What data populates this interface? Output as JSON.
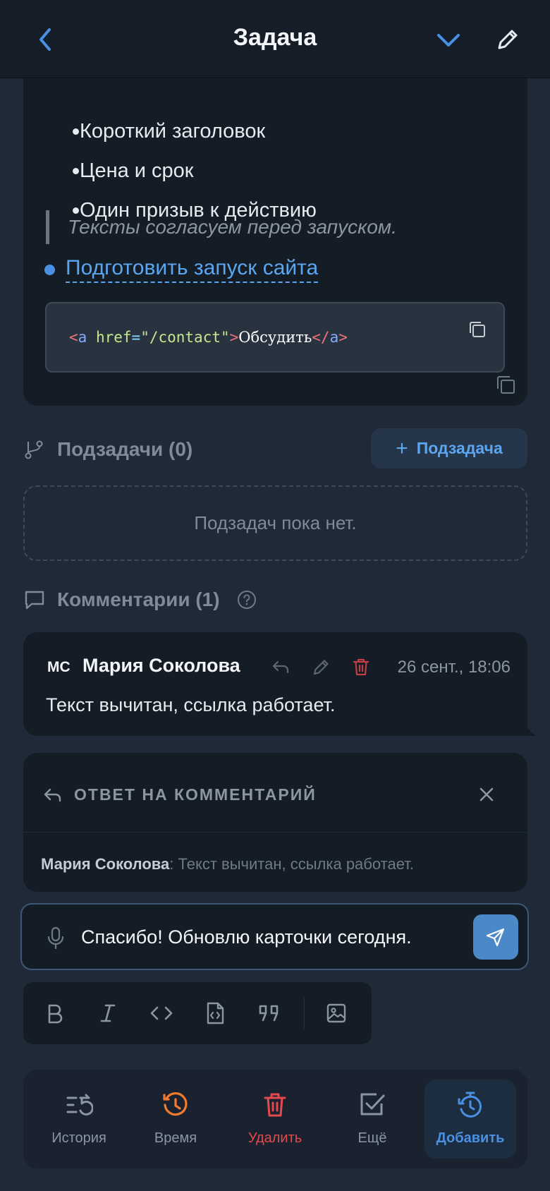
{
  "header": {
    "title": "Задача"
  },
  "description": {
    "bullets": [
      "Короткий заголовок",
      "Цена и срок",
      "Один призыв к действию"
    ],
    "quote": "Тексты согласуем перед запуском.",
    "task_link": "Подготовить запуск сайта",
    "code": {
      "open_bracket": "<",
      "tag": "a",
      "attr": "href",
      "eq": "=",
      "value": "\"/contact\"",
      "close_bracket": ">",
      "text": "Обсудить",
      "end_open": "</",
      "end_tag": "a",
      "end_close": ">"
    }
  },
  "subtasks": {
    "title": "Подзадачи (0)",
    "add_plus": "+",
    "add_label": "Подзадача",
    "empty_text": "Подзадач пока нет."
  },
  "comments": {
    "title": "Комментарии (1)",
    "items": [
      {
        "avatar": "МС",
        "author": "Мария Соколова",
        "time": "26 сент., 18:06",
        "text": "Текст вычитан, ссылка работает."
      }
    ]
  },
  "reply": {
    "label": "ОТВЕТ НА КОММЕНТАРИЙ",
    "quoted_author": "Мария Соколова",
    "separator": ":",
    "quoted_text": " Текст вычитан, ссылка работает."
  },
  "composer": {
    "value": "Спасибо! Обновлю карточки сегодня."
  },
  "toolbar": {
    "buttons": [
      "bold-icon",
      "italic-icon",
      "code-icon",
      "code-file-icon",
      "quote-icon",
      "image-icon"
    ]
  },
  "bottom_nav": {
    "items": [
      {
        "label": "История",
        "icon": "history-list-icon",
        "color": "#8c96a3"
      },
      {
        "label": "Время",
        "icon": "clock-history-icon",
        "color": "#f07a2e"
      },
      {
        "label": "Удалить",
        "icon": "trash-icon",
        "color": "#e5484d"
      },
      {
        "label": "Ещё",
        "icon": "checkbox-icon",
        "color": "#8c96a3"
      },
      {
        "label": "Добавить",
        "icon": "timer-add-icon",
        "color": "#4a90e2",
        "active": true
      }
    ]
  },
  "colors": {
    "background": "#1f2937",
    "card": "#141c26",
    "accent": "#4a90e2",
    "danger": "#e5484d",
    "warning": "#f07a2e"
  }
}
